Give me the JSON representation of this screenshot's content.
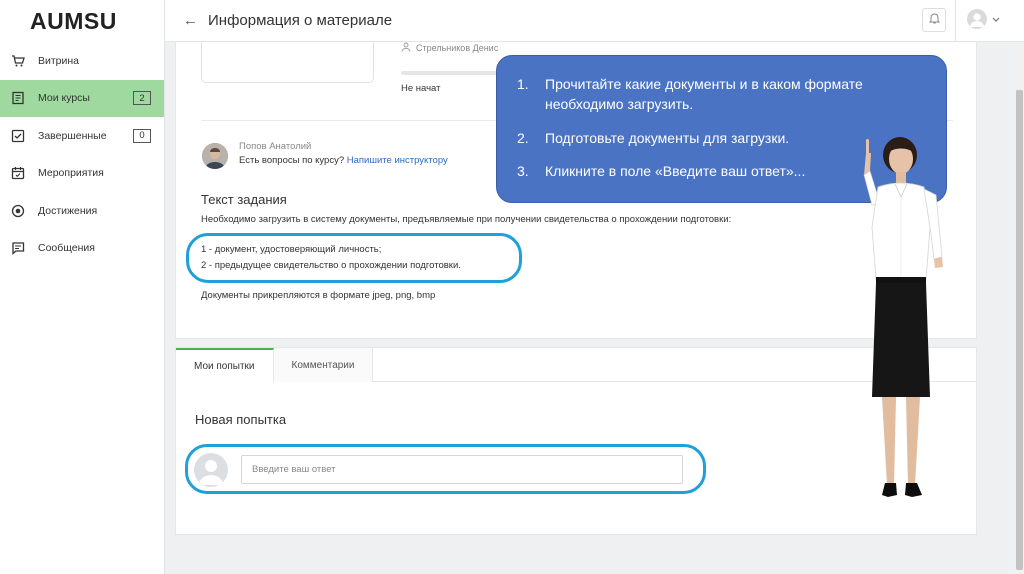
{
  "app": {
    "logo": "AUMSU"
  },
  "header": {
    "title": "Информация о материале",
    "back_icon": "arrow-left-icon"
  },
  "sidebar": {
    "items": [
      {
        "label": "Витрина",
        "icon": "cart-icon",
        "active": false,
        "badge": ""
      },
      {
        "label": "Мои курсы",
        "icon": "book-icon",
        "active": true,
        "badge": "2"
      },
      {
        "label": "Завершенные",
        "icon": "checkbox-icon",
        "active": false,
        "badge": "0"
      },
      {
        "label": "Мероприятия",
        "icon": "calendar-icon",
        "active": false,
        "badge": ""
      },
      {
        "label": "Достижения",
        "icon": "medal-icon",
        "active": false,
        "badge": ""
      },
      {
        "label": "Сообщения",
        "icon": "message-icon",
        "active": false,
        "badge": ""
      }
    ]
  },
  "material": {
    "author": "Стрельников Денис",
    "progress_fraction": 0,
    "status": "Не начат"
  },
  "tutor": {
    "name": "Попов Анатолий",
    "question": "Есть вопросы по курсу?",
    "link": "Напишите инструктору"
  },
  "task": {
    "heading": "Текст задания",
    "description": "Необходимо загрузить в систему документы, предъявляемые при получении свидетельства о прохождении подготовки:",
    "items": [
      "1 - документ, удостоверяющий личность;",
      "2 - предыдущее свидетельство о прохождении подготовки."
    ],
    "formats": "Документы прикрепляются в формате jpeg, png, bmp"
  },
  "tabs": [
    {
      "label": "Мои попытки",
      "active": true
    },
    {
      "label": "Комментарии",
      "active": false
    }
  ],
  "attempt": {
    "heading": "Новая попытка",
    "placeholder": "Введите ваш ответ"
  },
  "callout": {
    "steps": [
      {
        "num": "1.",
        "text": "Прочитайте какие документы и в каком формате необходимо загрузить."
      },
      {
        "num": "2.",
        "text": "Подготовьте документы для загрузки."
      },
      {
        "num": "3.",
        "text": "Кликните в поле «Введите ваш ответ»..."
      }
    ]
  },
  "colors": {
    "active_nav": "#9fd9a0",
    "highlight": "#1ea0d8",
    "callout_bg": "#4a73c4",
    "link": "#2a6cc4"
  }
}
